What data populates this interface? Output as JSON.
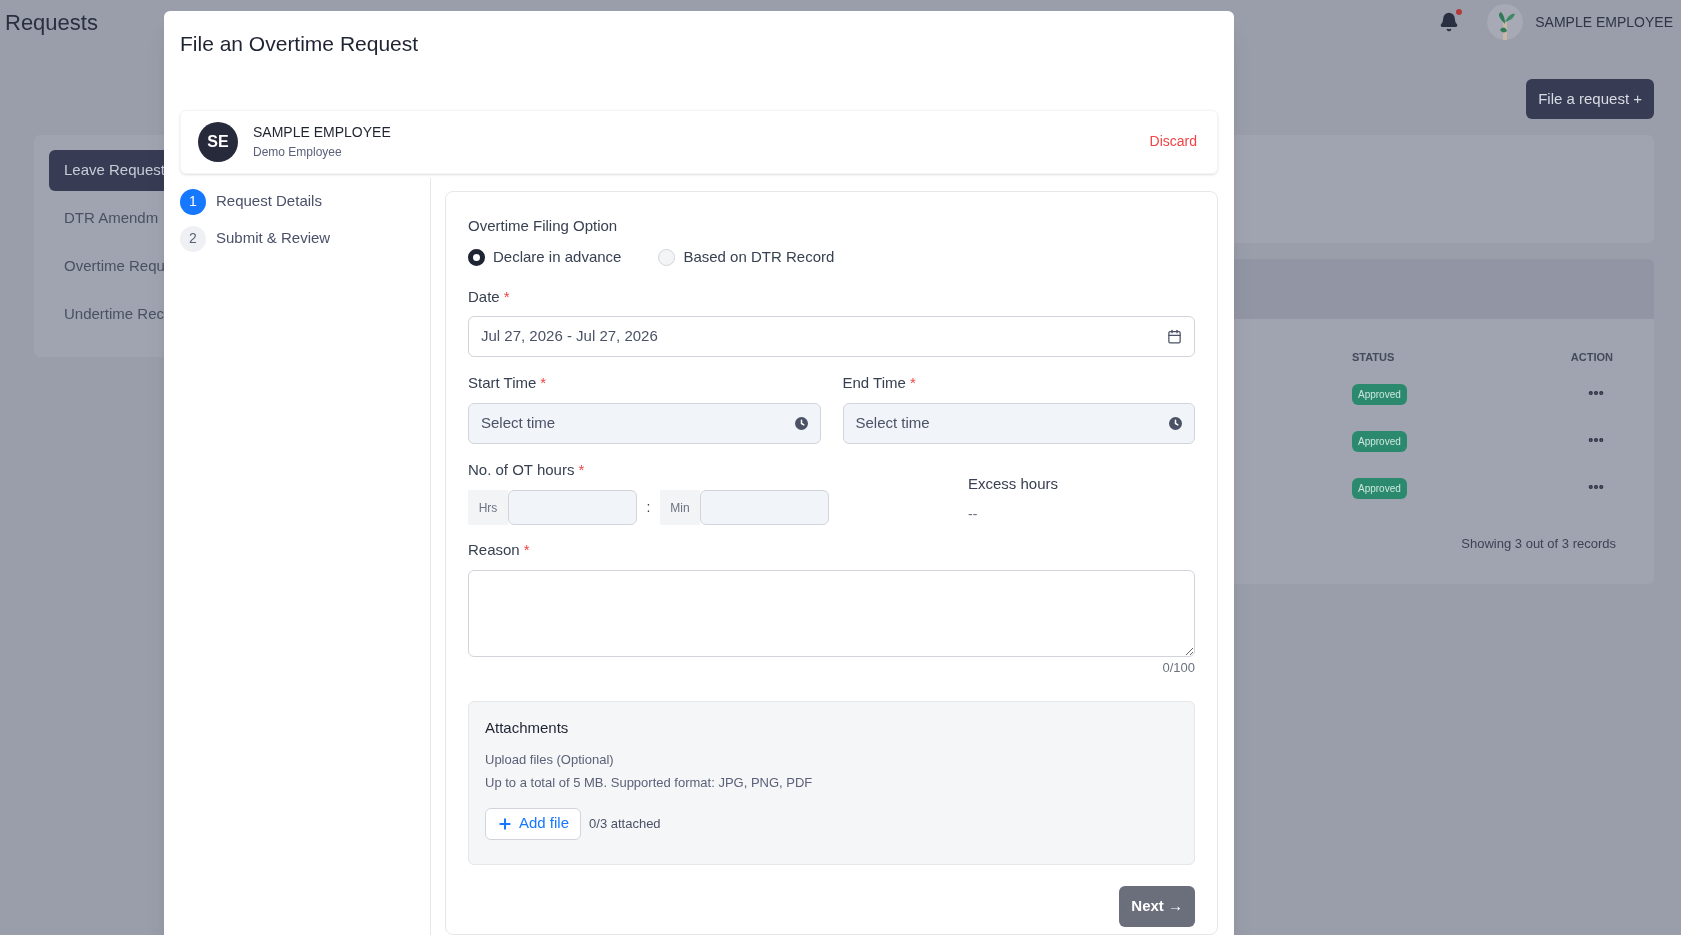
{
  "page": {
    "title": "Requests"
  },
  "topbar": {
    "notification": true,
    "user_name": "SAMPLE EMPLOYEE"
  },
  "file_request_button": "File a request +",
  "sidebar": {
    "items": [
      {
        "label": "Leave Request",
        "selected": true
      },
      {
        "label": "DTR Amendm",
        "selected": false
      },
      {
        "label": "Overtime Requ",
        "selected": false
      },
      {
        "label": "Undertime Rec",
        "selected": false
      }
    ]
  },
  "table": {
    "columns": [
      "STATUS",
      "ACTION"
    ],
    "rows": [
      {
        "status": "Approved"
      },
      {
        "status": "Approved"
      },
      {
        "status": "Approved"
      }
    ],
    "footer": "Showing 3 out of 3 records"
  },
  "modal": {
    "title": "File an Overtime Request",
    "employee": {
      "initials": "SE",
      "name": "SAMPLE EMPLOYEE",
      "role": "Demo Employee"
    },
    "discard": "Discard",
    "steps": [
      {
        "number": "1",
        "label": "Request Details",
        "selected": true
      },
      {
        "number": "2",
        "label": "Submit & Review",
        "selected": false
      }
    ],
    "filing_option": {
      "label": "Overtime Filing Option",
      "options": [
        {
          "label": "Declare in advance",
          "selected": true
        },
        {
          "label": "Based on DTR Record",
          "selected": false
        }
      ]
    },
    "date": {
      "label": "Date",
      "mark": "*",
      "value": "Jul 27, 2026 - Jul 27, 2026"
    },
    "start_time": {
      "label": "Start Time",
      "mark": "*",
      "placeholder": "Select time"
    },
    "end_time": {
      "label": "End Time",
      "mark": "*",
      "placeholder": "Select time"
    },
    "ot_hours": {
      "label": "No. of OT hours",
      "mark": "*",
      "hours_prefix": "Hrs",
      "separator": ":",
      "minutes_prefix": "Min"
    },
    "excess_hours": {
      "label": "Excess hours",
      "value": "--"
    },
    "reason": {
      "label": "Reason",
      "mark": "*",
      "counter": "0/100"
    },
    "attachments": {
      "title": "Attachments",
      "subtitle": "Upload files (Optional)",
      "note": "Up to a total of 5 MB. Supported format: JPG, PNG, PDF",
      "add_button": "Add file",
      "count": "0/3 attached"
    },
    "next_button": "Next →"
  }
}
